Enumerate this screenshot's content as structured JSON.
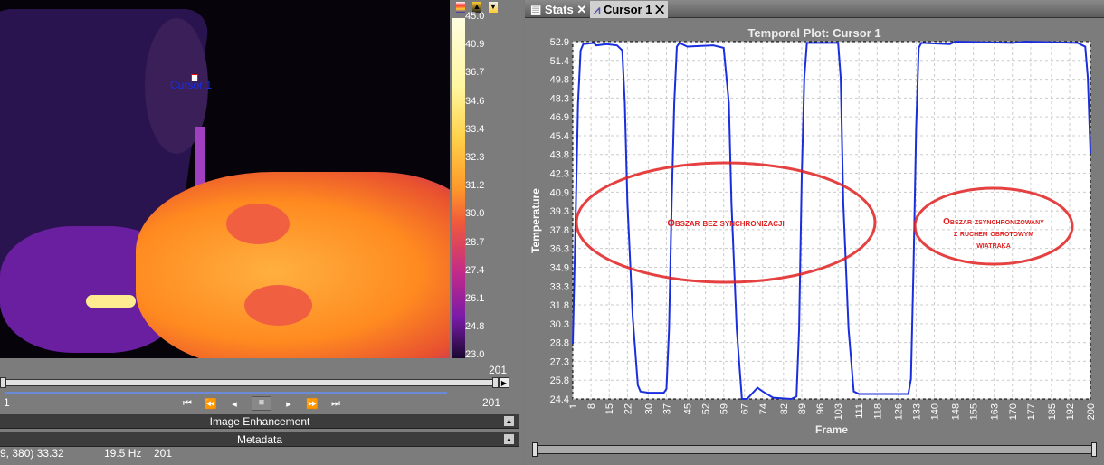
{
  "viewer": {
    "cursor_label": "Cursor 1",
    "colorbar_labels": [
      "45.0",
      "40.9",
      "36.7",
      "34.6",
      "33.4",
      "32.3",
      "31.2",
      "30.0",
      "28.7",
      "27.4",
      "26.1",
      "24.8",
      "23.0"
    ],
    "colorbar_icons": [
      "palette-icon",
      "raise-max-icon",
      "lower-min-icon"
    ],
    "frame_max_top": "201",
    "frame_start": "1",
    "frame_end": "201",
    "playback": [
      "skip-start-icon",
      "rewind-icon",
      "step-back-icon",
      "stop-icon",
      "step-forward-icon",
      "fast-forward-icon",
      "skip-end-icon"
    ],
    "panels": [
      "Image Enhancement",
      "Metadata"
    ],
    "status": {
      "coord_value": "9, 380) 33.32",
      "rate": "19.5 Hz",
      "frame": "201"
    }
  },
  "tabs": [
    {
      "label": "Stats",
      "icon": "table-icon",
      "active": false
    },
    {
      "label": "Cursor 1",
      "icon": "plot-icon",
      "active": true
    }
  ],
  "chart_data": {
    "type": "line",
    "title": "Temporal Plot: Cursor 1",
    "xlabel": "Frame",
    "ylabel": "Temperature",
    "ylim": [
      24.4,
      52.9
    ],
    "xlim": [
      1,
      200
    ],
    "yticks": [
      "52.9",
      "51.4",
      "49.8",
      "48.3",
      "46.9",
      "45.4",
      "43.8",
      "42.3",
      "40.9",
      "39.3",
      "37.8",
      "36.3",
      "34.9",
      "33.3",
      "31.8",
      "30.3",
      "28.8",
      "27.3",
      "25.8",
      "24.4"
    ],
    "xticks": [
      "1",
      "8",
      "15",
      "22",
      "30",
      "37",
      "45",
      "52",
      "59",
      "67",
      "74",
      "82",
      "89",
      "96",
      "103",
      "111",
      "118",
      "126",
      "133",
      "140",
      "148",
      "155",
      "163",
      "170",
      "177",
      "185",
      "192",
      "200"
    ],
    "grid": true,
    "color": "#1a2ee0",
    "series": [
      {
        "points": [
          [
            1,
            28.8
          ],
          [
            2,
            38
          ],
          [
            3,
            48
          ],
          [
            4,
            52.2
          ],
          [
            5,
            52.7
          ],
          [
            9,
            52.8
          ],
          [
            10,
            52.6
          ],
          [
            14,
            52.7
          ],
          [
            18,
            52.6
          ],
          [
            20,
            52.2
          ],
          [
            21,
            48
          ],
          [
            22,
            40
          ],
          [
            24,
            31
          ],
          [
            26,
            25.5
          ],
          [
            27,
            25
          ],
          [
            30,
            24.9
          ],
          [
            36,
            24.9
          ],
          [
            37,
            25.2
          ],
          [
            38,
            30
          ],
          [
            39,
            40
          ],
          [
            40,
            48
          ],
          [
            41,
            52.5
          ],
          [
            42,
            52.8
          ],
          [
            45,
            52.5
          ],
          [
            55,
            52.6
          ],
          [
            59,
            52.4
          ],
          [
            61,
            48
          ],
          [
            62,
            40
          ],
          [
            64,
            30
          ],
          [
            66,
            24.4
          ],
          [
            68,
            24.4
          ],
          [
            72,
            25.3
          ],
          [
            74,
            25
          ],
          [
            78,
            24.5
          ],
          [
            85,
            24.4
          ],
          [
            87,
            24.6
          ],
          [
            88,
            30
          ],
          [
            89,
            42
          ],
          [
            90,
            50
          ],
          [
            91,
            52.8
          ],
          [
            103,
            52.8
          ],
          [
            104,
            50
          ],
          [
            105,
            40
          ],
          [
            107,
            30
          ],
          [
            109,
            25
          ],
          [
            111,
            24.8
          ],
          [
            130,
            24.8
          ],
          [
            131,
            26
          ],
          [
            132,
            35
          ],
          [
            133,
            46
          ],
          [
            134,
            52.4
          ],
          [
            135,
            52.8
          ],
          [
            146,
            52.7
          ],
          [
            148,
            52.9
          ],
          [
            170,
            52.8
          ],
          [
            175,
            52.9
          ],
          [
            195,
            52.8
          ],
          [
            198,
            52.5
          ],
          [
            199,
            50
          ],
          [
            200,
            44
          ]
        ]
      }
    ],
    "annotations": [
      {
        "text": "Obszar bez synchronizacji",
        "color": "#e02020"
      },
      {
        "text": "Obszar zsynchronizowany z ruchem obrotowym wiatraka",
        "color": "#e02020"
      }
    ]
  }
}
